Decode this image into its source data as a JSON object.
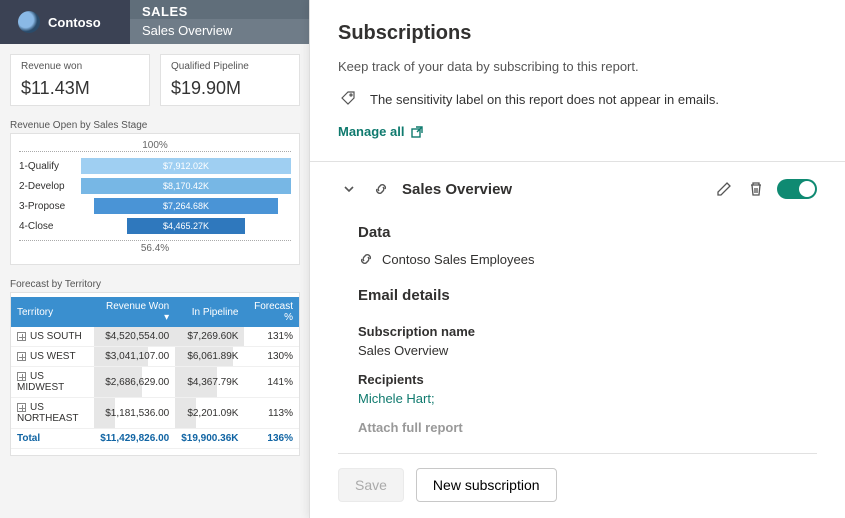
{
  "brand": "Contoso",
  "top": {
    "section": "SALES",
    "page": "Sales Overview"
  },
  "cards": {
    "revenue_won": {
      "label": "Revenue won",
      "value": "$11.43M"
    },
    "pipeline": {
      "label": "Qualified Pipeline",
      "value": "$19.90M"
    }
  },
  "stage_chart_title": "Revenue Open by Sales Stage",
  "forecast_title": "Forecast by Territory",
  "chart_data": [
    {
      "type": "bar",
      "title": "Revenue Open by Sales Stage",
      "top_pct": "100%",
      "bottom_pct": "56.4%",
      "bars": [
        {
          "label": "1-Qualify",
          "value_text": "$7,912.02K",
          "pct": 100,
          "color": "#9fcff2"
        },
        {
          "label": "2-Develop",
          "value_text": "$8,170.42K",
          "pct": 100,
          "color": "#77b7e5"
        },
        {
          "label": "3-Propose",
          "value_text": "$7,264.68K",
          "pct": 88,
          "color": "#4a94d6"
        },
        {
          "label": "4-Close",
          "value_text": "$4,465.27K",
          "pct": 56,
          "color": "#2f78bd"
        }
      ]
    },
    {
      "type": "table",
      "title": "Forecast by Territory",
      "columns": [
        "Territory",
        "Revenue Won",
        "In Pipeline",
        "Forecast %"
      ],
      "rows": [
        {
          "territory": "US SOUTH",
          "revenue_won": "$4,520,554.00",
          "rev_bar": 100,
          "pipeline": "$7,269.60K",
          "pipe_bar": 100,
          "forecast": "131%"
        },
        {
          "territory": "US WEST",
          "revenue_won": "$3,041,107.00",
          "rev_bar": 67,
          "pipeline": "$6,061.89K",
          "pipe_bar": 83,
          "forecast": "130%"
        },
        {
          "territory": "US MIDWEST",
          "revenue_won": "$2,686,629.00",
          "rev_bar": 59,
          "pipeline": "$4,367.79K",
          "pipe_bar": 60,
          "forecast": "141%"
        },
        {
          "territory": "US NORTHEAST",
          "revenue_won": "$1,181,536.00",
          "rev_bar": 26,
          "pipeline": "$2,201.09K",
          "pipe_bar": 30,
          "forecast": "113%"
        }
      ],
      "total": {
        "territory": "Total",
        "revenue_won": "$11,429,826.00",
        "pipeline": "$19,900.36K",
        "forecast": "136%"
      }
    }
  ],
  "panel": {
    "title": "Subscriptions",
    "subtitle": "Keep track of your data by subscribing to this report.",
    "sensitivity": "The sensitivity label on this report does not appear in emails.",
    "manage": "Manage all",
    "sub_title": "Sales Overview",
    "data_heading": "Data",
    "data_value": "Contoso Sales Employees",
    "email_heading": "Email details",
    "name_label": "Subscription name",
    "name_value": "Sales Overview",
    "recipients_label": "Recipients",
    "recipients_value": "Michele Hart;",
    "attach_label": "Attach full report",
    "save": "Save",
    "new_sub": "New subscription"
  }
}
